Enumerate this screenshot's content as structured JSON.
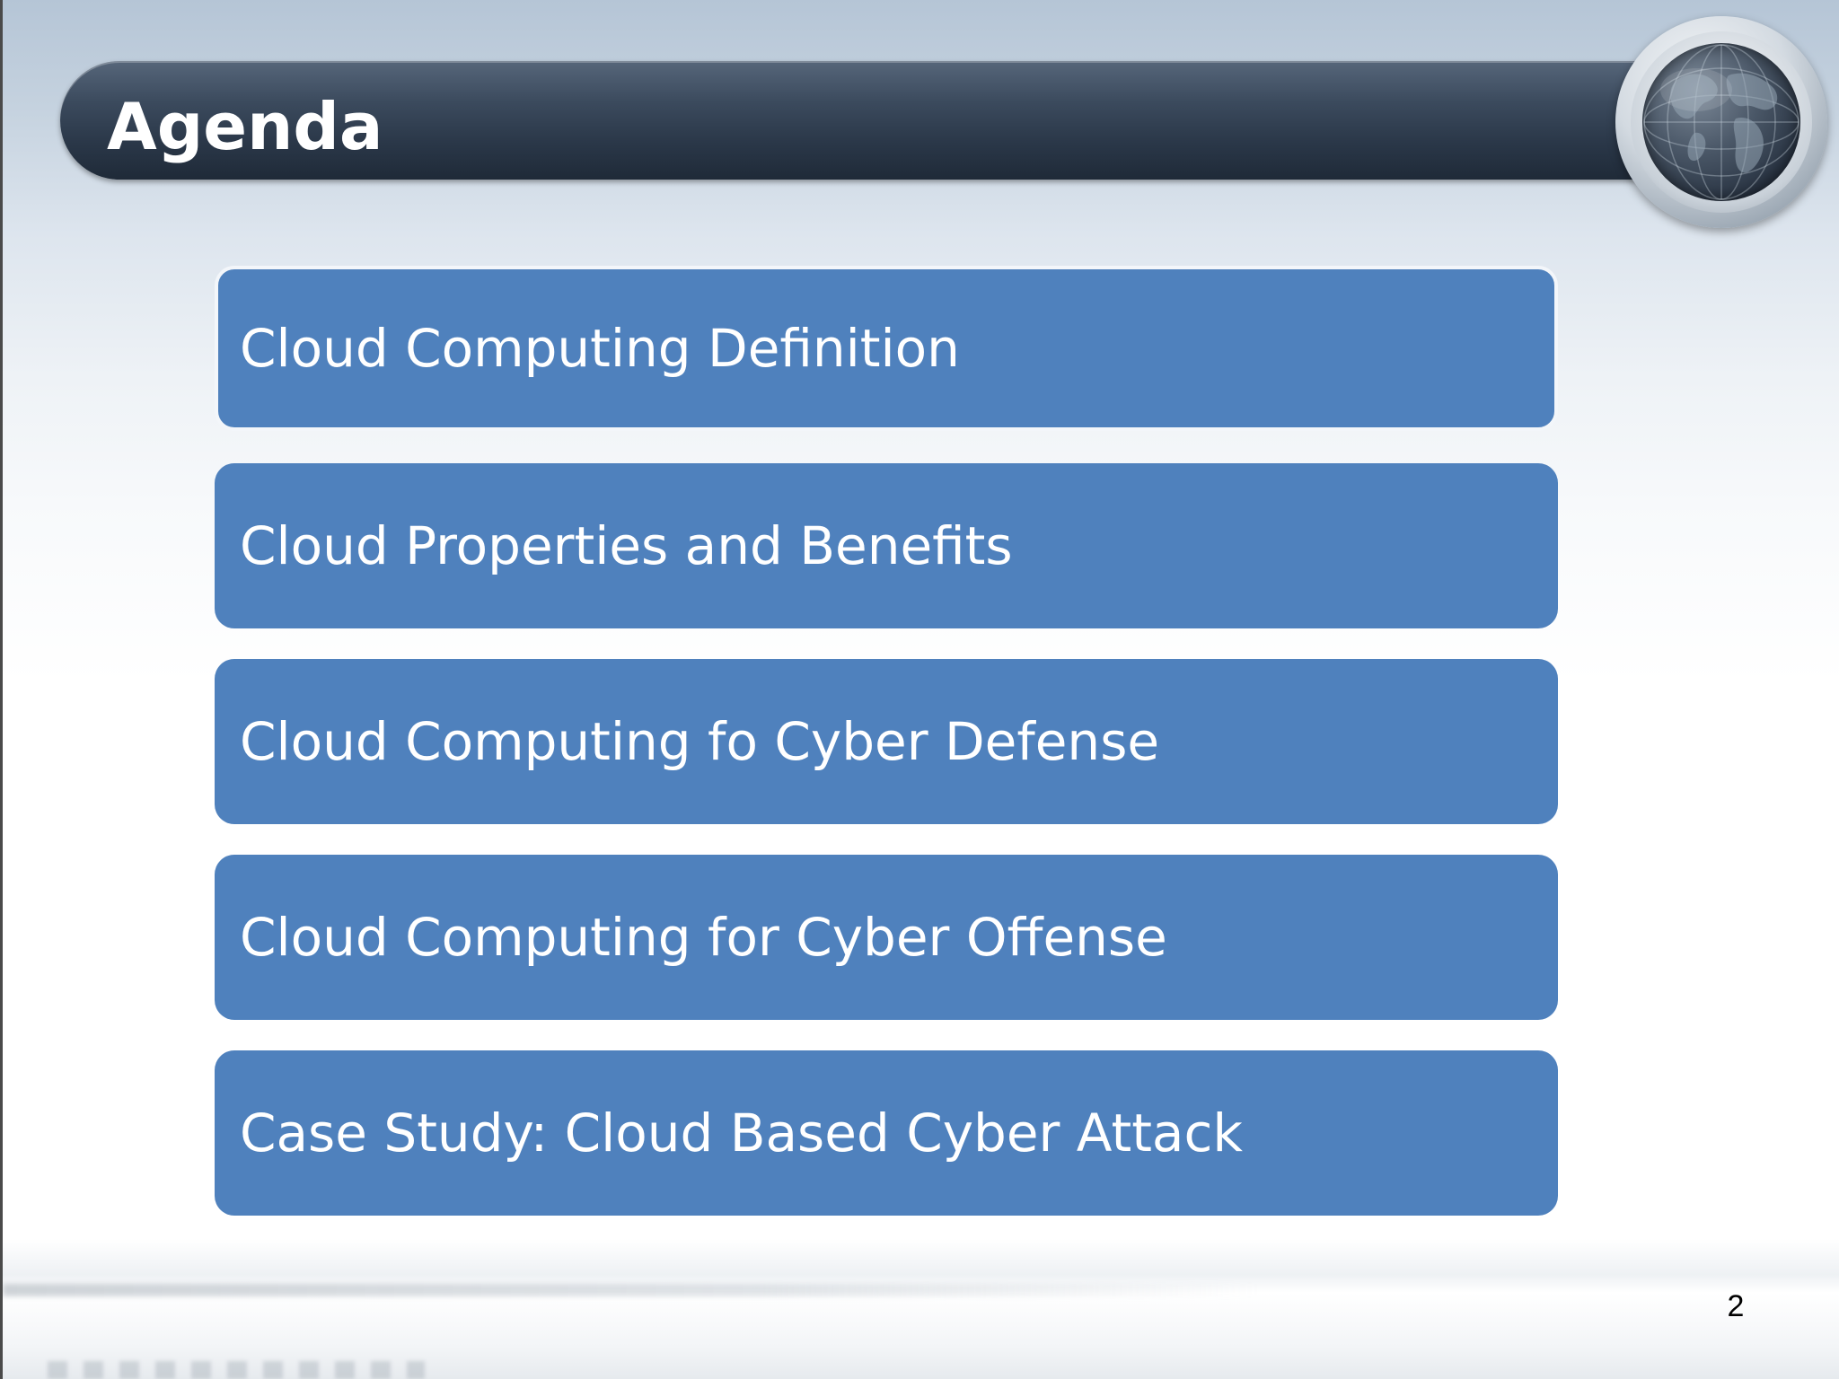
{
  "slide": {
    "title": "Agenda",
    "page_number": "2",
    "agenda_items": [
      {
        "label": "Cloud Computing Definition"
      },
      {
        "label": "Cloud Properties and Benefits"
      },
      {
        "label": "Cloud Computing fo Cyber Defense"
      },
      {
        "label": "Cloud Computing for Cyber Offense"
      },
      {
        "label": "Case Study: Cloud Based Cyber Attack"
      }
    ],
    "icons": [
      "globe-icon"
    ],
    "colors": {
      "item_fill": "#4f81bd",
      "title_bar": "#2a3748",
      "title_text": "#ffffff",
      "item_text": "#ffffff"
    }
  }
}
